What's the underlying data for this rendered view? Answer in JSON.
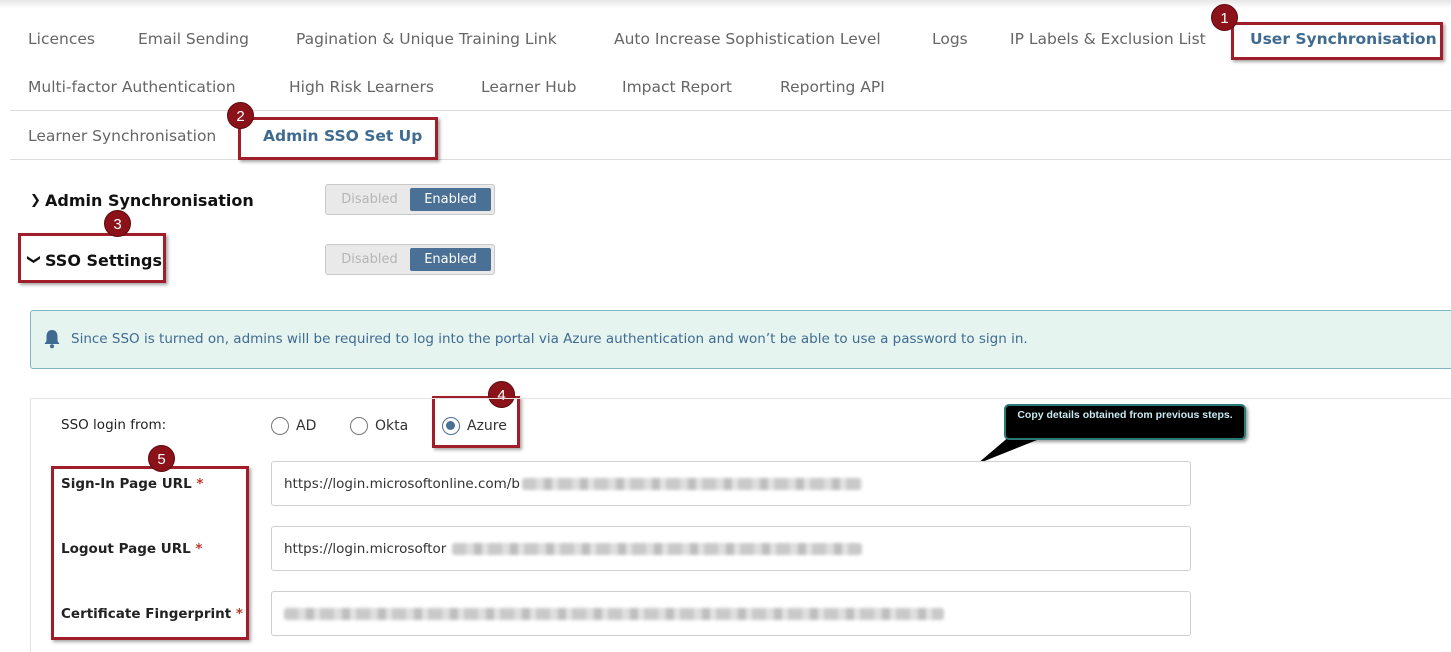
{
  "tabs_row1": [
    "Licences",
    "Email Sending",
    "Pagination & Unique Training Link",
    "Auto Increase Sophistication Level",
    "Logs",
    "IP Labels & Exclusion List",
    "User Synchronisation"
  ],
  "tabs_row2": [
    "Multi-factor Authentication",
    "High Risk Learners",
    "Learner Hub",
    "Impact Report",
    "Reporting API"
  ],
  "subtabs": [
    "Learner Synchronisation",
    "Admin SSO Set Up"
  ],
  "markers": [
    "1",
    "2",
    "3",
    "4",
    "5"
  ],
  "admin_sync": {
    "title": "Admin Synchronisation",
    "off_label": "Disabled",
    "on_label": "Enabled"
  },
  "sso_settings": {
    "title": "SSO Settings",
    "off_label": "Disabled",
    "on_label": "Enabled"
  },
  "alert": {
    "icon": "bell-icon",
    "message": "Since SSO is turned on, admins will be required to log into the portal via Azure authentication and won’t be able to use a password to sign in."
  },
  "sso_login": {
    "label": "SSO login from:",
    "options": [
      "AD",
      "Okta",
      "Azure"
    ],
    "selected": "Azure"
  },
  "callout": {
    "text": "Copy details obtained from previous steps."
  },
  "fields": {
    "sign_in": {
      "label": "Sign-In Page URL",
      "required_mark": "*",
      "value": "https://login.microsoftonline.com/b"
    },
    "logout": {
      "label": "Logout Page URL",
      "required_mark": "*",
      "value": "https://login.microsoftor"
    },
    "fingerprint": {
      "label": "Certificate Fingerprint",
      "required_mark": "*",
      "value": ""
    }
  },
  "colors": {
    "accent": "#4a7096",
    "highlight": "#a01e2a",
    "alert_bg": "#e6f4ef"
  }
}
